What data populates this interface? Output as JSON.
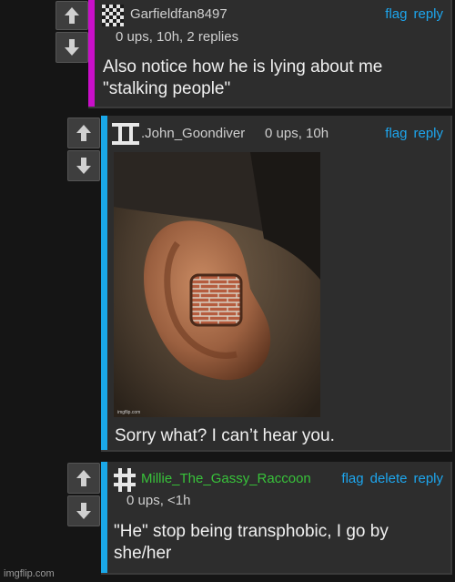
{
  "comments": [
    {
      "username": "Garfieldfan8497",
      "meta": "0 ups, 10h, 2 replies",
      "actions": [
        "flag",
        "reply"
      ],
      "text_lines": [
        "Also notice how he is lying about me",
        "\"stalking people\""
      ],
      "accent_color": "#c90fc9",
      "avatar_icon": "checkerboard-icon"
    },
    {
      "username": ".John_Goondiver",
      "meta": "0 ups, 10h",
      "actions": [
        "flag",
        "reply"
      ],
      "text_lines": [
        "Sorry what? I can’t hear you."
      ],
      "accent_color": "#1aa8e8",
      "avatar_icon": "roman-two-icon",
      "image_watermark": "imgflip.com"
    },
    {
      "username": "Millie_The_Gassy_Raccoon",
      "meta": "0 ups, <1h",
      "actions": [
        "flag",
        "delete",
        "reply"
      ],
      "text_lines": [
        "\"He\" stop being transphobic, I go by",
        "she/her"
      ],
      "accent_color": "#1aa8e8",
      "username_color": "#38c23a",
      "avatar_icon": "hash-icon"
    }
  ],
  "watermark": "imgflip.com"
}
